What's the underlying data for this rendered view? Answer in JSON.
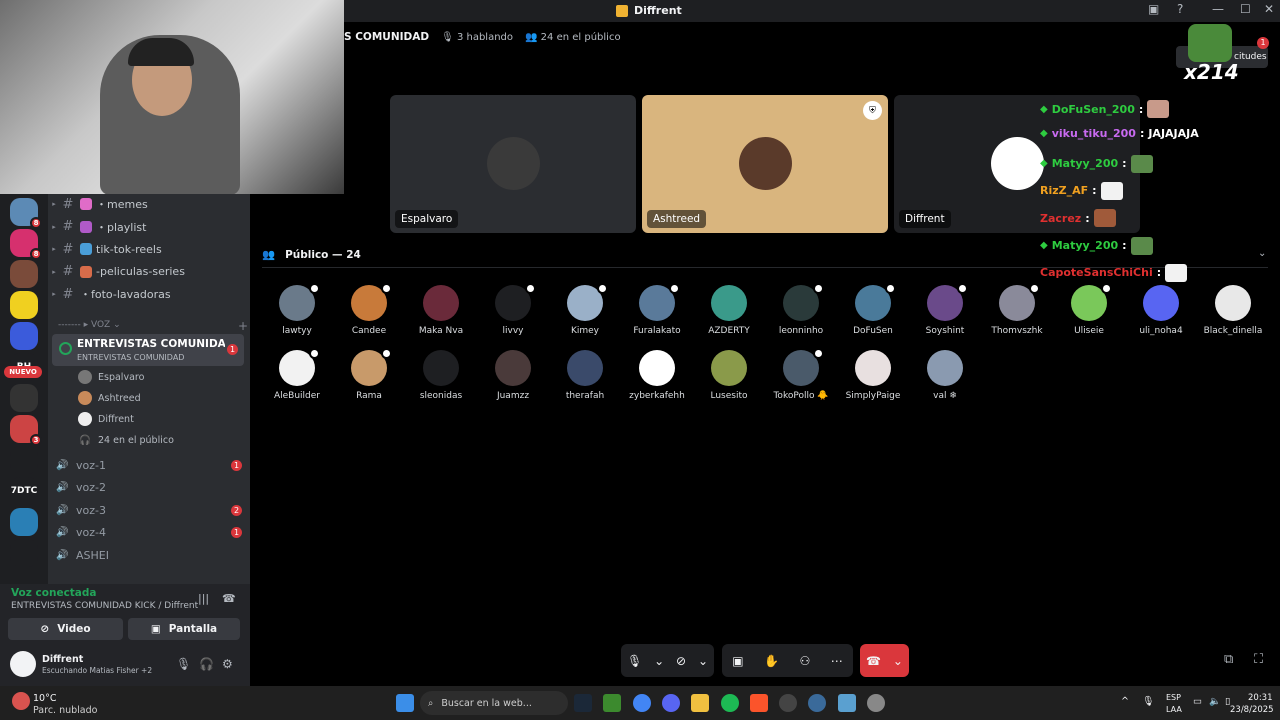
{
  "window": {
    "title": "Diffrent",
    "minimize": "—",
    "maximize": "☐",
    "close": "✕"
  },
  "server_rail": [
    {
      "label": "",
      "color": "#5c8ab5",
      "badge": "8"
    },
    {
      "label": "",
      "color": "#d6306e",
      "badge": "8"
    },
    {
      "label": "",
      "color": "#7a4b3a",
      "badge": ""
    },
    {
      "label": "",
      "color": "#f0d020",
      "badge": ""
    },
    {
      "label": "",
      "color": "#3b5bdb",
      "badge": ""
    },
    {
      "label": "BH",
      "color": "#1e1f22",
      "badge": ""
    },
    {
      "label": "",
      "color": "#333333",
      "badge": ""
    },
    {
      "label": "",
      "color": "#c44",
      "badge": "3"
    },
    {
      "label": "",
      "color": "#1e1f22",
      "badge": ""
    },
    {
      "label": "7DTC",
      "color": "#1e1f22",
      "badge": ""
    },
    {
      "label": "",
      "color": "#2a7fb5",
      "badge": ""
    },
    {
      "label": "",
      "color": "#1e1f22",
      "badge": ""
    }
  ],
  "nuevo": "NUEVO",
  "text_channels": [
    {
      "name": "・memes",
      "emo": "#e06cc8"
    },
    {
      "name": "・playlist",
      "emo": "#b05ac8"
    },
    {
      "name": "tik-tok-reels",
      "emo": "#4a9ed8"
    },
    {
      "name": "-peliculas-series",
      "emo": "#d86c4a"
    },
    {
      "name": "・foto-lavadoras",
      "emo": ""
    }
  ],
  "voice_header": "------- ▸ VOZ ⌄",
  "stage": {
    "name": "ENTREVISTAS COMUNIDAD KICK",
    "sub": "ENTREVISTAS COMUNIDAD",
    "badge": "1",
    "members": [
      {
        "name": "Espalvaro",
        "color": "#777"
      },
      {
        "name": "Ashtreed",
        "color": "#c88a5a"
      },
      {
        "name": "Diffrent",
        "color": "#eee"
      },
      {
        "name": "24 en el público",
        "color": ""
      }
    ]
  },
  "voice_channels": [
    {
      "name": "voz-1",
      "badge": "1"
    },
    {
      "name": "voz-2",
      "badge": ""
    },
    {
      "name": "voz-3",
      "badge": "2"
    },
    {
      "name": "voz-4",
      "badge": "1"
    },
    {
      "name": "ASHEI",
      "badge": ""
    }
  ],
  "voice_connected": {
    "status": "Voz conectada",
    "detail": "ENTREVISTAS COMUNIDAD KICK / Diffrent",
    "video": "Video",
    "screen": "Pantalla"
  },
  "user": {
    "name": "Diffrent",
    "listening": "Escuchando Matias Fisher +2"
  },
  "header_info": {
    "title": "S COMUNIDAD",
    "speaking": "3 hablando",
    "audience": "24 en el público",
    "requests": "citudes",
    "request_count": "1"
  },
  "speakers": [
    {
      "name": "Espalvaro",
      "bg": "#2b2d31",
      "av": "#3a3a3a",
      "mod": false
    },
    {
      "name": "Ashtreed",
      "bg": "#d9b57e",
      "av": "#5a3a2a",
      "mod": true
    },
    {
      "name": "Diffrent",
      "bg": "#1e1f22",
      "av": "#ffffff",
      "mod": false
    }
  ],
  "audience_header": "Público — 24",
  "audience": [
    {
      "name": "lawtyy",
      "color": "#6a7a8a",
      "mic": true
    },
    {
      "name": "Candee",
      "color": "#c87a3a",
      "mic": true
    },
    {
      "name": "Maka Nva",
      "color": "#6a2a3a",
      "mic": false
    },
    {
      "name": "livvy",
      "color": "#1e1f22",
      "mic": true
    },
    {
      "name": "Kimey",
      "color": "#9ab0c8",
      "mic": true
    },
    {
      "name": "Furalakato",
      "color": "#5a7a9a",
      "mic": true
    },
    {
      "name": "AZDERTY",
      "color": "#3a9a8a",
      "mic": false
    },
    {
      "name": "leonninho",
      "color": "#2a3a3a",
      "mic": true
    },
    {
      "name": "DoFuSen",
      "color": "#4a7a9a",
      "mic": true
    },
    {
      "name": "Soyshint",
      "color": "#6a4a8a",
      "mic": true
    },
    {
      "name": "Thomvszhk",
      "color": "#8a8a9a",
      "mic": true
    },
    {
      "name": "Uliseie",
      "color": "#7ac85a",
      "mic": true
    },
    {
      "name": "uli_noha4",
      "color": "#5865f2",
      "mic": false
    },
    {
      "name": "Black_dinella",
      "color": "#e8e8e8",
      "mic": false
    },
    {
      "name": "AleBuilder",
      "color": "#f2f2f2",
      "mic": true
    },
    {
      "name": "Rama",
      "color": "#c89a6a",
      "mic": true
    },
    {
      "name": "sleonidas",
      "color": "#1e1f22",
      "mic": false
    },
    {
      "name": "Juamzz",
      "color": "#4a3a3a",
      "mic": false
    },
    {
      "name": "therafah",
      "color": "#3a4a6a",
      "mic": false
    },
    {
      "name": "zyberkafehh",
      "color": "#ffffff",
      "mic": false
    },
    {
      "name": "Lusesito",
      "color": "#8a9a4a",
      "mic": false
    },
    {
      "name": "TokoPollo 🐥",
      "color": "#4a5a6a",
      "mic": true
    },
    {
      "name": "SimplyPaige",
      "color": "#e8e0e0",
      "mic": false
    },
    {
      "name": "val ❄",
      "color": "#8a9ab0",
      "mic": false
    }
  ],
  "stream_chat": [
    {
      "user": "DoFuSen_200",
      "color": "#2ecc40",
      "msg": "",
      "emote": "#c89a8a"
    },
    {
      "user": "viku_tiku_200",
      "color": "#c86af0",
      "msg": "JAJAJAJA",
      "emote": ""
    },
    {
      "user": "Matyy_200",
      "color": "#2ecc40",
      "msg": "",
      "emote": "#5a8a4a"
    },
    {
      "user": "RizZ_AF",
      "color": "#f0a020",
      "msg": "",
      "emote": "#f2f2f2"
    },
    {
      "user": "Zacrez",
      "color": "#e03030",
      "msg": "",
      "emote": "#a05a3a"
    },
    {
      "user": "Matyy_200",
      "color": "#2ecc40",
      "msg": "",
      "emote": "#5a8a4a"
    },
    {
      "user": "CapoteSansChiChi",
      "color": "#e03030",
      "msg": "",
      "emote": "#f2f2f2"
    }
  ],
  "sub_counter": "x214",
  "taskbar": {
    "weather_temp": "10°C",
    "weather_desc": "Parc. nublado",
    "search": "Buscar en la web...",
    "lang1": "ESP",
    "lang2": "LAA",
    "time": "20:31",
    "date": "23/8/2025"
  }
}
